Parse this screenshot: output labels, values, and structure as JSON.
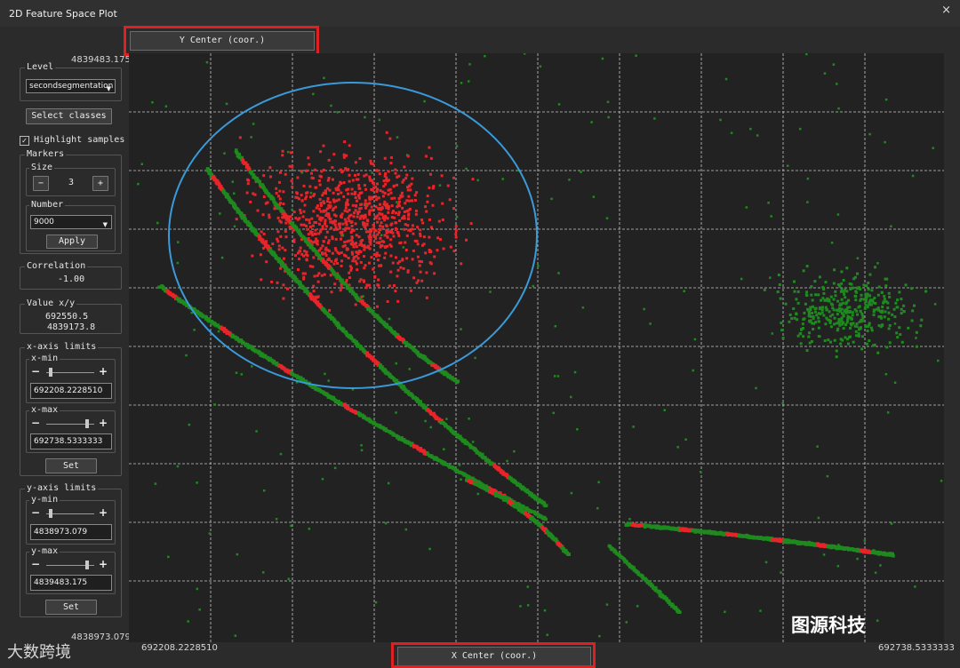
{
  "window": {
    "title": "2D Feature Space Plot",
    "close_glyph": "×"
  },
  "axes": {
    "y_button": "Y Center (coor.)",
    "x_button": "X Center (coor.)",
    "y_max_label": "4839483.175",
    "y_min_label": "4838973.079",
    "x_min_label": "692208.2228510",
    "x_max_label": "692738.5333333"
  },
  "panel": {
    "level_title": "Level",
    "level_value": "secondsegmentation",
    "select_classes": "Select classes",
    "highlight_label": "Highlight samples",
    "highlight_checked": true,
    "markers_title": "Markers",
    "size_title": "Size",
    "size_minus": "−",
    "size_value": "3",
    "size_plus": "+",
    "number_title": "Number",
    "number_value": "9000",
    "apply": "Apply",
    "correlation_title": "Correlation",
    "correlation_value": "-1.00",
    "value_title": "Value x/y",
    "value_x": "692550.5",
    "value_y": "4839173.8",
    "xlimits_title": "x-axis limits",
    "xmin_title": "x-min",
    "xmin_value": "692208.2228510",
    "xmin_fraction": 0.1,
    "xmax_title": "x-max",
    "xmax_value": "692738.5333333",
    "xmax_fraction": 0.85,
    "x_set": "Set",
    "ylimits_title": "y-axis limits",
    "ymin_title": "y-min",
    "ymin_value": "4838973.079",
    "ymin_fraction": 0.1,
    "ymax_title": "y-max",
    "ymax_value": "4839483.175",
    "ymax_fraction": 0.85,
    "y_set": "Set",
    "minus": "−",
    "plus": "+"
  },
  "colors": {
    "class_a": "#1f8a1f",
    "class_b": "#e8252a",
    "grid": "#c8c8c8",
    "annotation_ellipse": "#3a9ad9",
    "highlight_box": "#e02020"
  },
  "watermarks": {
    "left": "大数跨境",
    "right": "图源科技"
  }
}
